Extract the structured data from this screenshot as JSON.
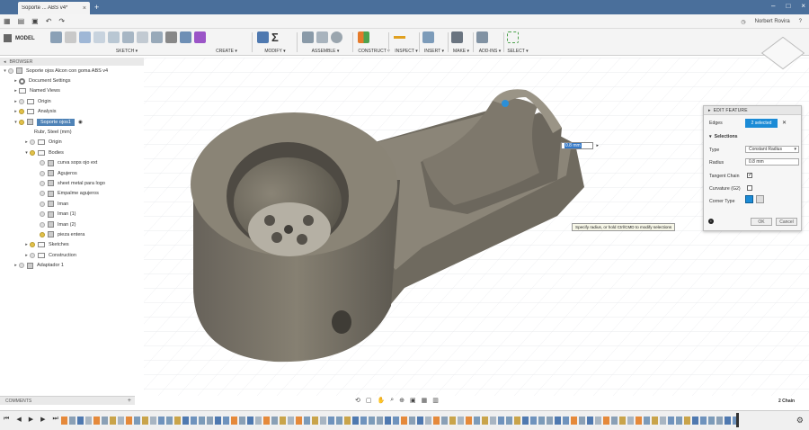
{
  "window": {
    "tab_title": "Soporte ... ABS v4*",
    "user": "Norbert Rovira"
  },
  "toolbar": {
    "mode": "MODEL",
    "groups": [
      {
        "label": "SKETCH ▾"
      },
      {
        "label": "CREATE ▾"
      },
      {
        "label": "MODIFY ▾"
      },
      {
        "label": "ASSEMBLE ▾"
      },
      {
        "label": "CONSTRUCT ▾"
      },
      {
        "label": "INSPECT ▾"
      },
      {
        "label": "INSERT ▾"
      },
      {
        "label": "MAKE ▾"
      },
      {
        "label": "ADD-INS ▾"
      },
      {
        "label": "SELECT ▾"
      }
    ]
  },
  "browser": {
    "title": "BROWSER",
    "items": [
      {
        "label": "Soporte ojos Alcon con goma ABS v4"
      },
      {
        "label": "Document Settings"
      },
      {
        "label": "Named Views"
      },
      {
        "label": "Origin"
      },
      {
        "label": "Analysis"
      },
      {
        "label": "Soporte ojos1"
      },
      {
        "label": "Rubr, Steel (mm)"
      },
      {
        "label": "Origin"
      },
      {
        "label": "Bodies"
      },
      {
        "label": "curva sops ojo ext"
      },
      {
        "label": "Agujeros"
      },
      {
        "label": "sheet metal para logo"
      },
      {
        "label": "Empalme agujeros"
      },
      {
        "label": "Iman"
      },
      {
        "label": "Iman (1)"
      },
      {
        "label": "Iman (2)"
      },
      {
        "label": "pieza entera"
      },
      {
        "label": "Sketches"
      },
      {
        "label": "Construction"
      },
      {
        "label": "Adaptador 1"
      }
    ]
  },
  "comments": {
    "label": "COMMENTS"
  },
  "status": {
    "chain": "2 Chain"
  },
  "edit_feature": {
    "title": "EDIT FEATURE",
    "edges_label": "Edges",
    "edges_value": "2 selected",
    "section": "Selections",
    "type_label": "Type",
    "type_value": "Constant Radius",
    "radius_label": "Radius",
    "radius_value": "0.8 mm",
    "tangent_label": "Tangent Chain",
    "curvature_label": "Curvature (G2)",
    "corner_label": "Corner Type",
    "ok": "OK",
    "cancel": "Cancel"
  },
  "canvas": {
    "radius_input": "0.8 mm",
    "tooltip": "Specify radius, or hold Ctrl/CMD to modify selections"
  },
  "colors": {
    "title_bar": "#4a6f9b",
    "selected": "#1b8bd6",
    "body": "#6f6a5f"
  }
}
